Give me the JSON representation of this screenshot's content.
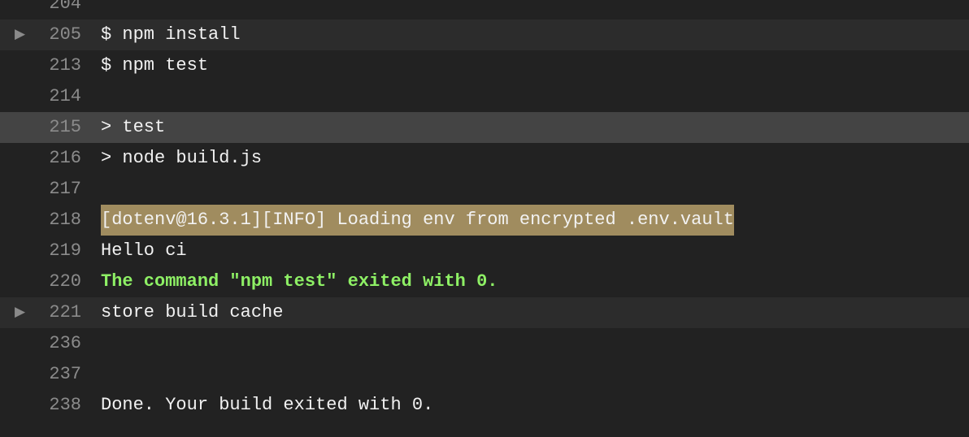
{
  "colors": {
    "background": "#222222",
    "fold_row": "#2c2c2c",
    "highlight_row": "#444444",
    "warn_bg": "#a08c5f",
    "success_text": "#8ef065",
    "line_number": "#8b8b8b"
  },
  "icons": {
    "fold_toggle": "triangle-right-icon"
  },
  "lines": [
    {
      "num": "204",
      "text": ""
    },
    {
      "num": "205",
      "text": "$ npm install",
      "fold": true
    },
    {
      "num": "213",
      "text": "$ npm test"
    },
    {
      "num": "214",
      "text": ""
    },
    {
      "num": "215",
      "text": "> test",
      "highlight": true
    },
    {
      "num": "216",
      "text": "> node build.js"
    },
    {
      "num": "217",
      "text": ""
    },
    {
      "num": "218",
      "text": "[dotenv@16.3.1][INFO] Loading env from encrypted .env.vault",
      "style": "warn"
    },
    {
      "num": "219",
      "text": "Hello ci"
    },
    {
      "num": "220",
      "text": "The command \"npm test\" exited with 0.",
      "style": "success"
    },
    {
      "num": "221",
      "text": "store build cache",
      "fold": true
    },
    {
      "num": "236",
      "text": ""
    },
    {
      "num": "237",
      "text": ""
    },
    {
      "num": "238",
      "text": "Done. Your build exited with 0."
    }
  ]
}
